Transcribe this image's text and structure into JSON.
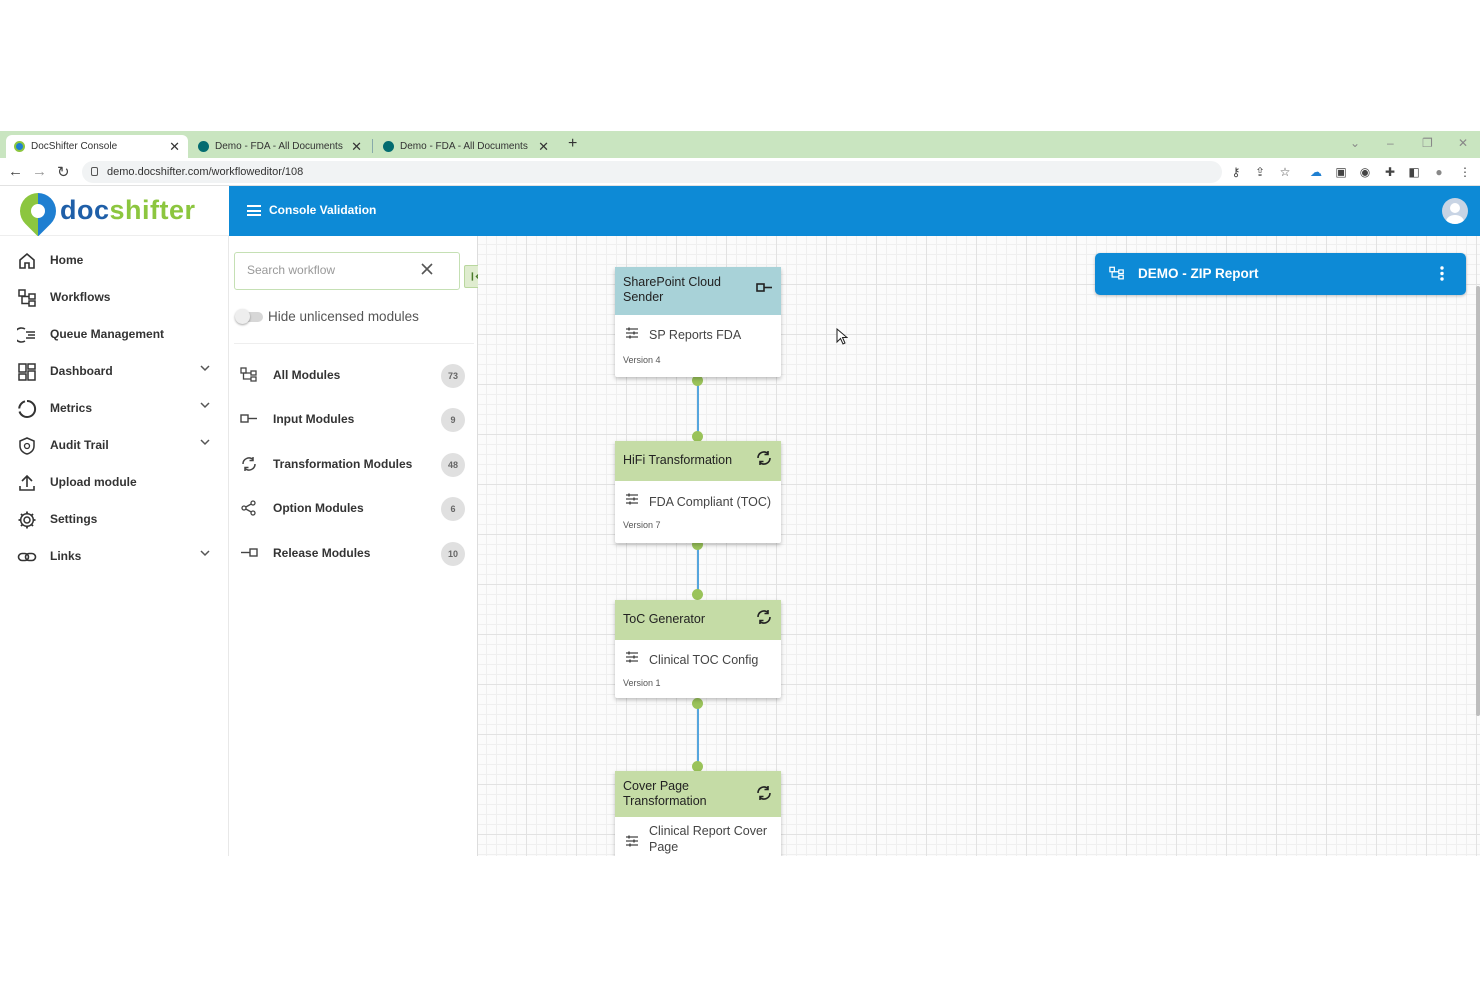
{
  "browser": {
    "tabs": [
      {
        "title": "DocShifter Console",
        "favicon_color": "#1f7fd1"
      },
      {
        "title": "Demo - FDA - All Documents",
        "favicon_color": "#036c70"
      },
      {
        "title": "Demo - FDA - All Documents",
        "favicon_color": "#036c70"
      }
    ],
    "url": "demo.docshifter.com/workfloweditor/108"
  },
  "app": {
    "logo_prefix": "doc",
    "logo_suffix": "shifter",
    "header_title": "Console Validation",
    "accent_color": "#0d8ad6",
    "brand_green": "#8cc63f"
  },
  "sidebar": {
    "items": [
      {
        "label": "Home",
        "icon": "home-icon",
        "expandable": false
      },
      {
        "label": "Workflows",
        "icon": "workflow-icon",
        "expandable": false
      },
      {
        "label": "Queue Management",
        "icon": "queue-icon",
        "expandable": false
      },
      {
        "label": "Dashboard",
        "icon": "dashboard-icon",
        "expandable": true
      },
      {
        "label": "Metrics",
        "icon": "metrics-icon",
        "expandable": true
      },
      {
        "label": "Audit Trail",
        "icon": "shield-icon",
        "expandable": true
      },
      {
        "label": "Upload module",
        "icon": "upload-icon",
        "expandable": false
      },
      {
        "label": "Settings",
        "icon": "gear-icon",
        "expandable": false
      },
      {
        "label": "Links",
        "icon": "link-icon",
        "expandable": true
      }
    ]
  },
  "modules_panel": {
    "search_placeholder": "Search workflow",
    "toggle_label": "Hide unlicensed modules",
    "categories": [
      {
        "label": "All Modules",
        "count": "73",
        "icon": "workflow-icon"
      },
      {
        "label": "Input Modules",
        "count": "9",
        "icon": "input-module-icon"
      },
      {
        "label": "Transformation Modules",
        "count": "48",
        "icon": "transform-icon"
      },
      {
        "label": "Option Modules",
        "count": "6",
        "icon": "share-icon"
      },
      {
        "label": "Release Modules",
        "count": "10",
        "icon": "release-module-icon"
      }
    ]
  },
  "workflow": {
    "title": "DEMO - ZIP Report",
    "nodes": [
      {
        "name": "SharePoint Cloud Sender",
        "kind": "input",
        "config": "SP Reports FDA",
        "version": "Version 4"
      },
      {
        "name": "HiFi Transformation",
        "kind": "transformation",
        "config": "FDA Compliant (TOC)",
        "version": "Version 7"
      },
      {
        "name": "ToC Generator",
        "kind": "transformation",
        "config": "Clinical TOC Config",
        "version": "Version 1"
      },
      {
        "name": "Cover Page Transformation",
        "kind": "transformation",
        "config": "Clinical Report Cover Page",
        "version": ""
      }
    ]
  }
}
